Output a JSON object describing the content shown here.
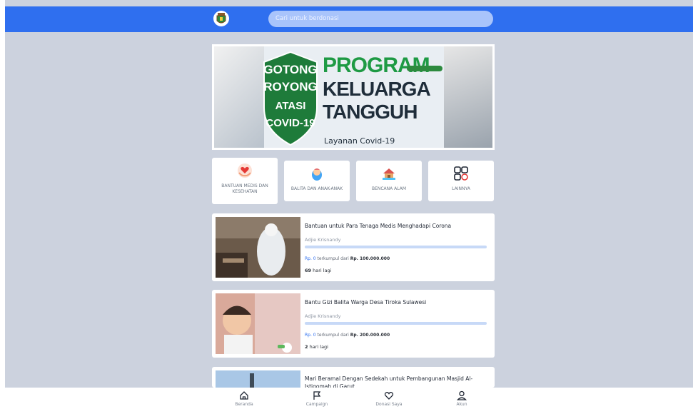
{
  "colors": {
    "primary": "#2f6fef",
    "background": "#ccd2de",
    "card": "#ffffff",
    "progress_track": "#c7d9f7"
  },
  "header": {
    "logo_icon": "emblem-logo",
    "search_placeholder": "Cari untuk berdonasi"
  },
  "banner": {
    "badge_lines": [
      "GOTONG",
      "ROYONG",
      "ATASI",
      "COVID-19"
    ],
    "program": "PROGRAM",
    "line2": "KELUARGA",
    "line3": "TANGGUH",
    "subtitle": "Layanan Covid-19"
  },
  "categories": [
    {
      "label": "BANTUAN MEDIS DAN KESEHATAN",
      "icon": "heart-hand-icon"
    },
    {
      "label": "BALITA DAN ANAK-ANAK",
      "icon": "baby-icon"
    },
    {
      "label": "BENCANA ALAM",
      "icon": "house-disaster-icon"
    },
    {
      "label": "LAINNYA",
      "icon": "grid-icon"
    }
  ],
  "campaigns": [
    {
      "title": "Bantuan untuk Para Tenaga Medis Menghadapi Corona",
      "organizer": "Adjie Krisnandy",
      "raised": "Rp. 0",
      "raised_mid": "terkumpul dari",
      "target": "Rp. 100.000.000",
      "days_number": "69",
      "days_suffix": "hari lagi",
      "progress": 0
    },
    {
      "title": "Bantu Gizi Balita Warga Desa Tiroka Sulawesi",
      "organizer": "Adjie Krisnandy",
      "raised": "Rp. 0",
      "raised_mid": "terkumpul dari",
      "target": "Rp. 200.000.000",
      "days_number": "2",
      "days_suffix": "hari lagi",
      "progress": 0
    },
    {
      "title": "Mari Beramal Dengan Sedekah untuk Pembangunan Masjid Al-Istiqomah di Garut"
    }
  ],
  "bottom_nav": [
    {
      "label": "Beranda",
      "icon": "home-icon"
    },
    {
      "label": "Campaign",
      "icon": "flag-icon"
    },
    {
      "label": "Donasi Saya",
      "icon": "heart-icon"
    },
    {
      "label": "Akun",
      "icon": "user-icon"
    }
  ]
}
